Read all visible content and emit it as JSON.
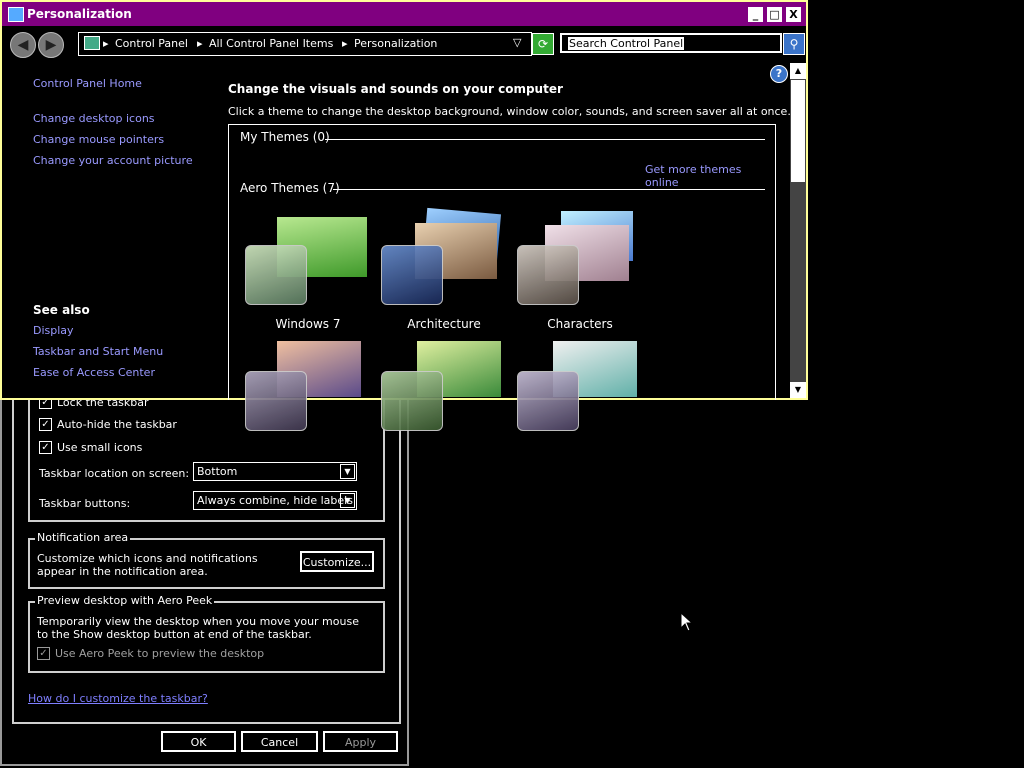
{
  "window": {
    "title": "Personalization",
    "controls": {
      "minimize": "_",
      "maximize": "□",
      "close": "X"
    }
  },
  "address": {
    "breadcrumb": [
      "Control Panel",
      "All Control Panel Items",
      "Personalization"
    ],
    "search_value": "Search Control Panel"
  },
  "left_pane": {
    "home": "Control Panel Home",
    "links": [
      "Change desktop icons",
      "Change mouse pointers",
      "Change your account picture"
    ],
    "see_also_title": "See also",
    "see_also": [
      "Display",
      "Taskbar and Start Menu",
      "Ease of Access Center"
    ]
  },
  "main": {
    "heading": "Change the visuals and sounds on your computer",
    "subheading": "Click a theme to change the desktop background, window color, sounds, and screen saver all at once.",
    "my_themes": "My Themes (0)",
    "more_themes_link": "Get more themes online",
    "aero_themes": "Aero Themes (7)",
    "themes": [
      {
        "name": "Windows 7",
        "color": "#6fbf3f"
      },
      {
        "name": "Architecture",
        "color": "#3a6fb0"
      },
      {
        "name": "Characters",
        "color": "#c8a0c8"
      },
      {
        "name": "",
        "color": "#8a6a9a"
      },
      {
        "name": "",
        "color": "#6aa63a"
      },
      {
        "name": "",
        "color": "#8fc8c0"
      }
    ]
  },
  "taskbar_dialog": {
    "checkboxes": [
      {
        "label": "Lock the taskbar",
        "checked": true
      },
      {
        "label": "Auto-hide the taskbar",
        "checked": true
      },
      {
        "label": "Use small icons",
        "checked": true
      }
    ],
    "location_label": "Taskbar location on screen:",
    "location_value": "Bottom",
    "buttons_label": "Taskbar buttons:",
    "buttons_value": "Always combine, hide labels",
    "notification_title": "Notification area",
    "notification_text": "Customize which icons and notifications appear in the notification area.",
    "customize_button": "Customize...",
    "peek_title": "Preview desktop with Aero Peek",
    "peek_text": "Temporarily view the desktop when you move your mouse to the Show desktop button at end of the taskbar.",
    "peek_checkbox": "Use Aero Peek to preview the desktop",
    "help_link": "How do I customize the taskbar?",
    "ok": "OK",
    "cancel": "Cancel",
    "apply": "Apply"
  }
}
